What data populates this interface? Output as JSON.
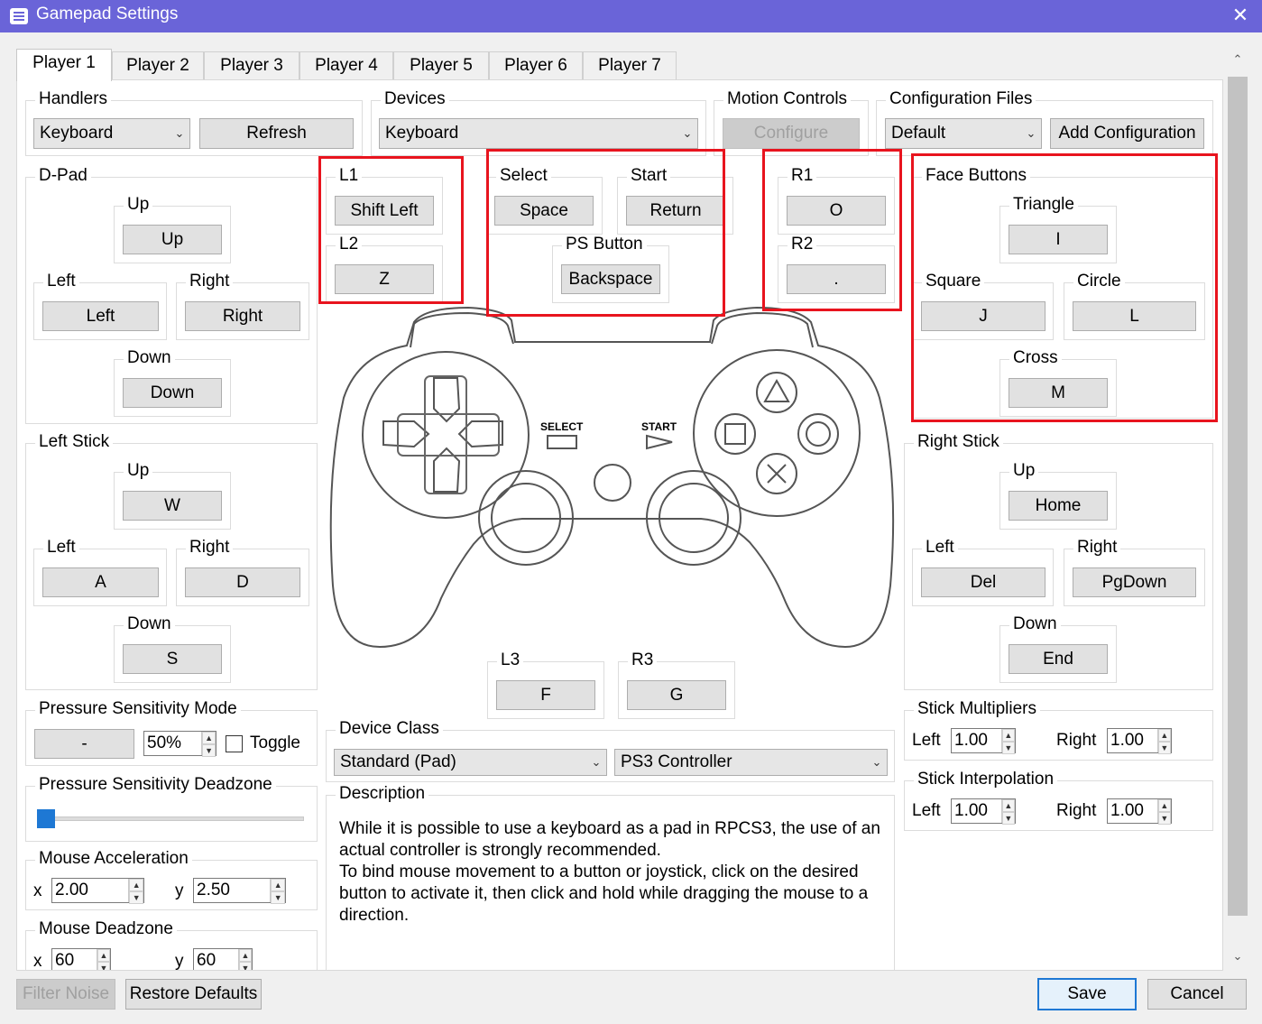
{
  "window": {
    "title": "Gamepad Settings",
    "close": "✕"
  },
  "tabs": [
    "Player 1",
    "Player 2",
    "Player 3",
    "Player 4",
    "Player 5",
    "Player 6",
    "Player 7"
  ],
  "handlers": {
    "title": "Handlers",
    "selected": "Keyboard",
    "refresh": "Refresh"
  },
  "devices": {
    "title": "Devices",
    "selected": "Keyboard"
  },
  "motion": {
    "title": "Motion Controls",
    "configure": "Configure"
  },
  "config_files": {
    "title": "Configuration Files",
    "selected": "Default",
    "add": "Add Configuration"
  },
  "dpad": {
    "title": "D-Pad",
    "up_label": "Up",
    "up": "Up",
    "left_label": "Left",
    "left": "Left",
    "right_label": "Right",
    "right": "Right",
    "down_label": "Down",
    "down": "Down"
  },
  "left_stick": {
    "title": "Left Stick",
    "up_label": "Up",
    "up": "W",
    "left_label": "Left",
    "left": "A",
    "right_label": "Right",
    "right": "D",
    "down_label": "Down",
    "down": "S"
  },
  "l1": {
    "label": "L1",
    "value": "Shift Left"
  },
  "l2": {
    "label": "L2",
    "value": "Z"
  },
  "select": {
    "label": "Select",
    "value": "Space"
  },
  "start": {
    "label": "Start",
    "value": "Return"
  },
  "ps_button": {
    "label": "PS Button",
    "value": "Backspace"
  },
  "r1": {
    "label": "R1",
    "value": "O"
  },
  "r2": {
    "label": "R2",
    "value": "."
  },
  "face": {
    "title": "Face Buttons",
    "triangle_label": "Triangle",
    "triangle": "I",
    "square_label": "Square",
    "square": "J",
    "circle_label": "Circle",
    "circle": "L",
    "cross_label": "Cross",
    "cross": "M"
  },
  "controller_image": {
    "select_text": "SELECT",
    "start_text": "START"
  },
  "right_stick": {
    "title": "Right Stick",
    "up_label": "Up",
    "up": "Home",
    "left_label": "Left",
    "left": "Del",
    "right_label": "Right",
    "right": "PgDown",
    "down_label": "Down",
    "down": "End"
  },
  "l3": {
    "label": "L3",
    "value": "F"
  },
  "r3": {
    "label": "R3",
    "value": "G"
  },
  "pressure_mode": {
    "title": "Pressure Sensitivity Mode",
    "button": "-",
    "value": "50%",
    "toggle_label": "Toggle",
    "toggle_checked": false
  },
  "pressure_deadzone": {
    "title": "Pressure Sensitivity Deadzone",
    "level": 0.0
  },
  "mouse_accel": {
    "title": "Mouse Acceleration",
    "x_label": "x",
    "x": "2.00",
    "y_label": "y",
    "y": "2.50"
  },
  "mouse_deadzone": {
    "title": "Mouse Deadzone",
    "x_label": "x",
    "x": "60",
    "y_label": "y",
    "y": "60"
  },
  "device_class": {
    "title": "Device Class",
    "class_selected": "Standard (Pad)",
    "type_selected": "PS3 Controller"
  },
  "description": {
    "title": "Description",
    "text": "While it is possible to use a keyboard as a pad in RPCS3, the use of an actual controller is strongly recommended.\nTo bind mouse movement to a button or joystick, click on the desired button to activate it, then click and hold while dragging the mouse to a direction."
  },
  "stick_multipliers": {
    "title": "Stick Multipliers",
    "left_label": "Left",
    "left": "1.00",
    "right_label": "Right",
    "right": "1.00"
  },
  "stick_interpolation": {
    "title": "Stick Interpolation",
    "left_label": "Left",
    "left": "1.00",
    "right_label": "Right",
    "right": "1.00"
  },
  "footer": {
    "filter_noise": "Filter Noise",
    "restore_defaults": "Restore Defaults",
    "save": "Save",
    "cancel": "Cancel"
  },
  "colors": {
    "titlebar": "#6a64d8",
    "highlight": "#e8141e",
    "primary_border": "#1e78d4"
  }
}
